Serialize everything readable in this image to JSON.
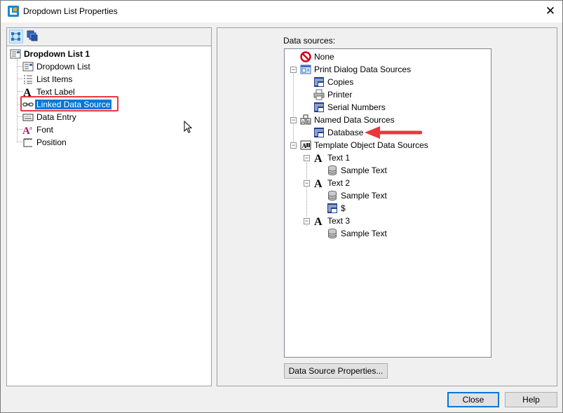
{
  "window": {
    "title": "Dropdown List Properties"
  },
  "left_panel": {
    "root": "Dropdown List 1",
    "items": [
      {
        "label": "Dropdown List",
        "icon": "dropdown-list-icon"
      },
      {
        "label": "List Items",
        "icon": "list-items-icon"
      },
      {
        "label": "Text Label",
        "icon": "text-a-icon"
      },
      {
        "label": "Linked Data Source",
        "icon": "link-icon",
        "selected": true
      },
      {
        "label": "Data Entry",
        "icon": "keyboard-icon"
      },
      {
        "label": "Font",
        "icon": "font-icon"
      },
      {
        "label": "Position",
        "icon": "ruler-icon"
      }
    ]
  },
  "right_panel": {
    "label": "Data sources:",
    "tree": {
      "none": "None",
      "print_dialog": {
        "label": "Print Dialog Data Sources",
        "children": [
          "Copies",
          "Printer",
          "Serial Numbers"
        ]
      },
      "named": {
        "label": "Named Data Sources",
        "children": [
          "Database"
        ]
      },
      "template": {
        "label": "Template Object Data Sources",
        "text1": {
          "label": "Text 1",
          "children": [
            "Sample Text"
          ]
        },
        "text2": {
          "label": "Text 2",
          "children": [
            "Sample Text",
            "$"
          ]
        },
        "text3": {
          "label": "Text 3",
          "children": [
            "Sample Text"
          ]
        }
      }
    },
    "properties_button": "Data Source Properties..."
  },
  "footer": {
    "close": "Close",
    "help": "Help"
  },
  "colors": {
    "accent": "#0078d7",
    "highlight_red": "#e8383d"
  }
}
